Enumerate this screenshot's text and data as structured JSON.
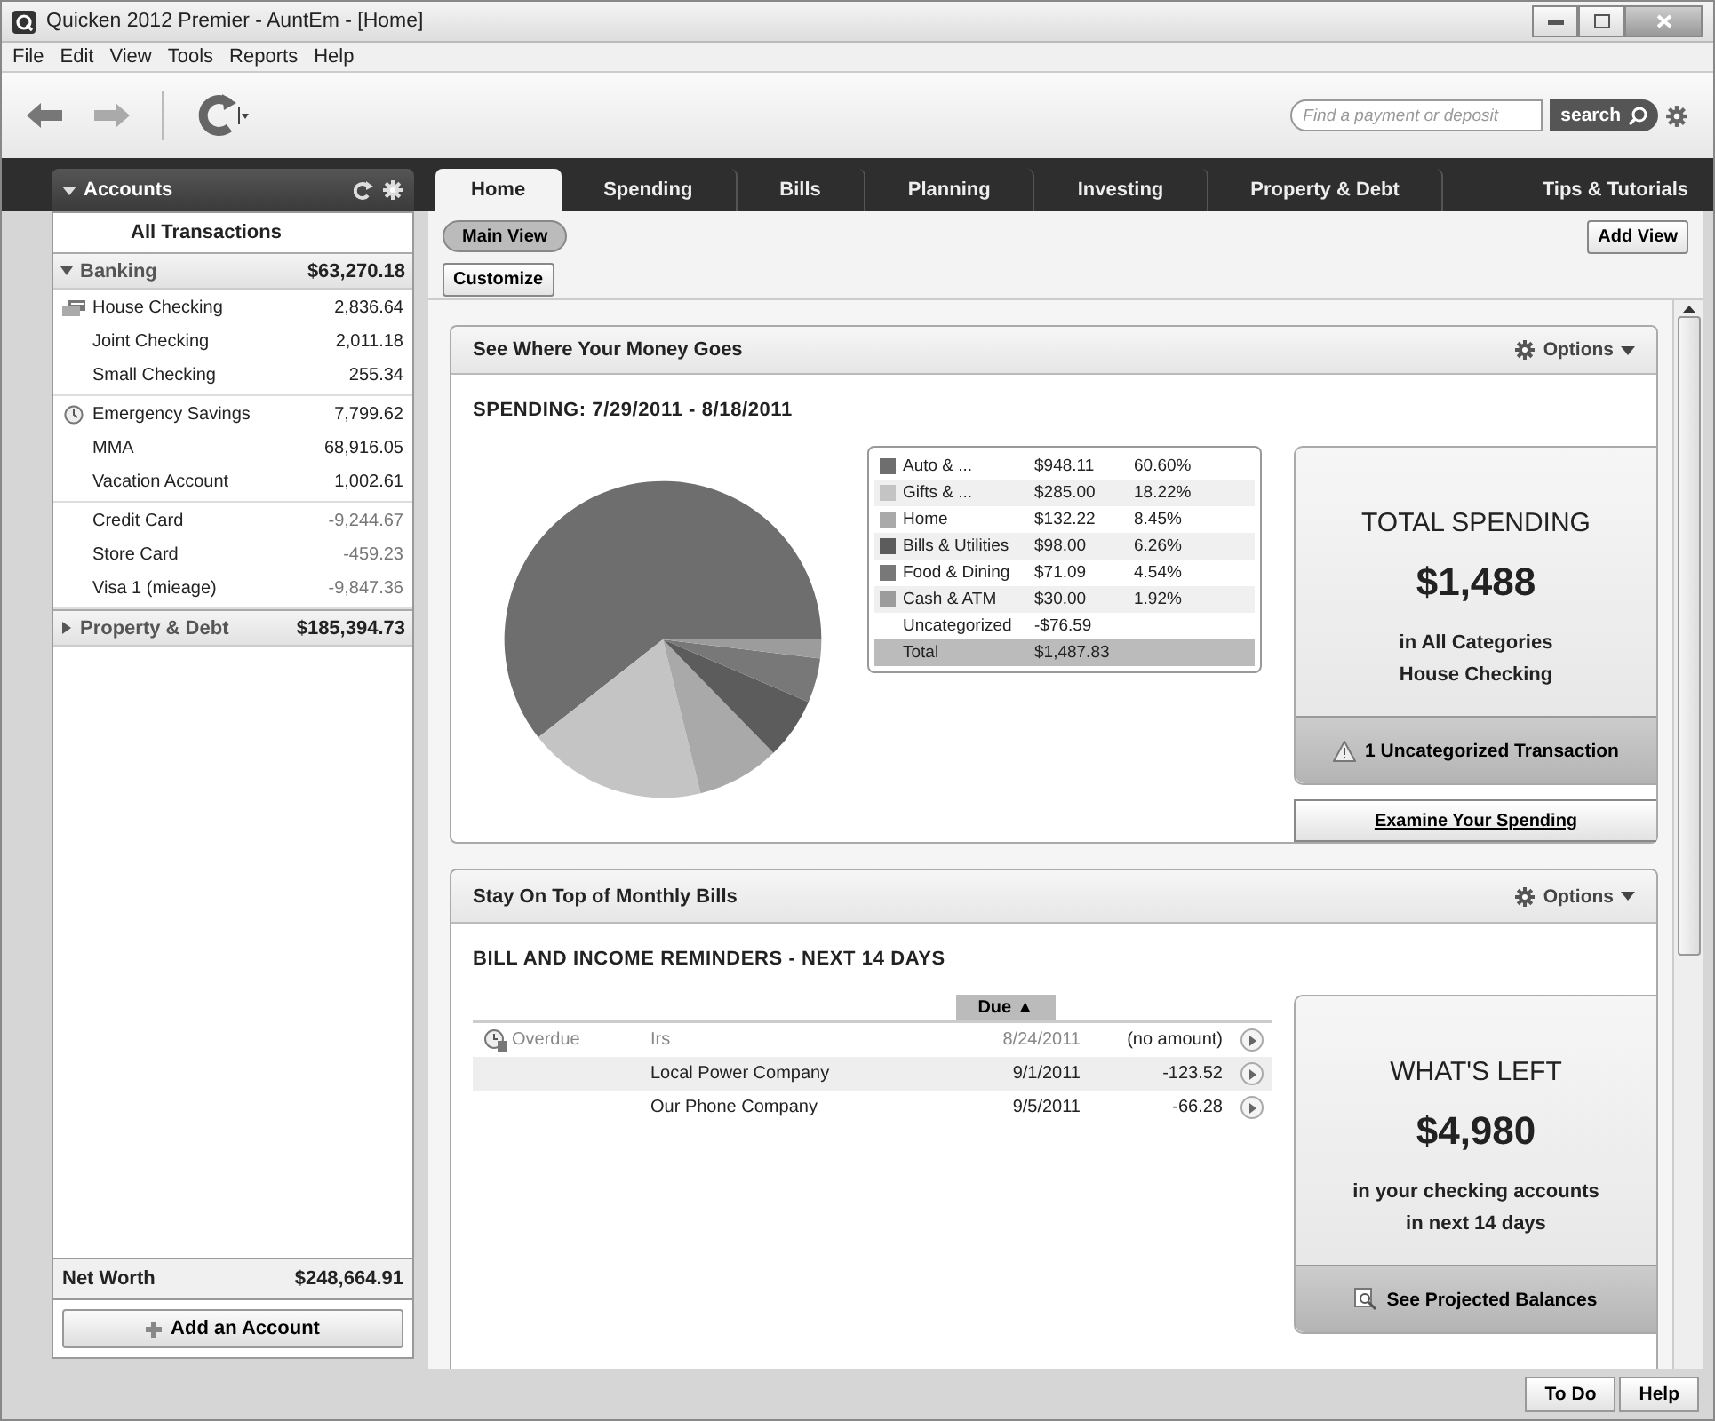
{
  "window": {
    "title": "Quicken 2012 Premier - AuntEm - [Home]"
  },
  "menu": [
    "File",
    "Edit",
    "View",
    "Tools",
    "Reports",
    "Help"
  ],
  "search": {
    "placeholder": "Find a payment or deposit",
    "button": "search"
  },
  "tabs": [
    {
      "label": "Home",
      "selected": true
    },
    {
      "label": "Spending",
      "selected": false
    },
    {
      "label": "Bills",
      "selected": false
    },
    {
      "label": "Planning",
      "selected": false
    },
    {
      "label": "Investing",
      "selected": false
    },
    {
      "label": "Property & Debt",
      "selected": false
    }
  ],
  "tips_tab": "Tips & Tutorials",
  "sidebar": {
    "title": "Accounts",
    "all": "All Transactions",
    "groups": [
      {
        "name": "Banking",
        "total": "$63,270.18",
        "expanded": true,
        "subgroups": [
          [
            {
              "name": "House Checking",
              "balance": "2,836.64",
              "kind": "card",
              "negative": false
            },
            {
              "name": "Joint Checking",
              "balance": "2,011.18",
              "kind": "plain",
              "negative": false
            },
            {
              "name": "Small Checking",
              "balance": "255.34",
              "kind": "plain",
              "negative": false
            }
          ],
          [
            {
              "name": "Emergency Savings",
              "balance": "7,799.62",
              "kind": "clock",
              "negative": false
            },
            {
              "name": "MMA",
              "balance": "68,916.05",
              "kind": "plain",
              "negative": false
            },
            {
              "name": "Vacation Account",
              "balance": "1,002.61",
              "kind": "plain",
              "negative": false
            }
          ],
          [
            {
              "name": "Credit Card",
              "balance": "-9,244.67",
              "kind": "plain",
              "negative": true
            },
            {
              "name": "Store Card",
              "balance": "-459.23",
              "kind": "plain",
              "negative": true
            },
            {
              "name": "Visa 1 (mieage)",
              "balance": "-9,847.36",
              "kind": "plain",
              "negative": true
            }
          ]
        ]
      },
      {
        "name": "Property & Debt",
        "total": "$185,394.73",
        "expanded": false
      }
    ],
    "net_worth": {
      "label": "Net Worth",
      "value": "$248,664.91"
    },
    "add_button": "Add an Account"
  },
  "views": [
    {
      "label": "Main View",
      "selected": true
    }
  ],
  "add_view": "Add View",
  "customize": "Customize",
  "spending": {
    "title": "See Where Your Money Goes",
    "options": "Options",
    "heading": "SPENDING: 7/29/2011 - 8/18/2011",
    "chart_data": {
      "type": "pie",
      "categories": [
        "Auto & ...",
        "Gifts & ...",
        "Home",
        "Bills & Utilities",
        "Food & Dining",
        "Cash & ATM"
      ],
      "values": [
        60.6,
        18.22,
        8.45,
        6.26,
        4.54,
        1.92
      ]
    },
    "legend": [
      {
        "amount": "$948.11",
        "percent": "60.60%",
        "color": "#6e6e6e"
      },
      {
        "amount": "$285.00",
        "percent": "18.22%",
        "color": "#c4c4c4"
      },
      {
        "amount": "$132.22",
        "percent": "8.45%",
        "color": "#a9a9a9"
      },
      {
        "amount": "$98.00",
        "percent": "6.26%",
        "color": "#5c5c5c"
      },
      {
        "amount": "$71.09",
        "percent": "4.54%",
        "color": "#787878"
      },
      {
        "amount": "$30.00",
        "percent": "1.92%",
        "color": "#9c9c9c"
      }
    ],
    "extra_rows": [
      {
        "label": "Uncategorized",
        "amount": "-$76.59",
        "total": false
      },
      {
        "label": "Total",
        "amount": "$1,487.83",
        "total": true
      }
    ],
    "summary": {
      "title": "TOTAL SPENDING",
      "amount": "$1,488",
      "lines": [
        "in All Categories",
        "House Checking"
      ],
      "footer": "1 Uncategorized Transaction"
    },
    "action": "Examine Your Spending"
  },
  "bills": {
    "title": "Stay On Top of Monthly Bills",
    "options": "Options",
    "heading": "BILL AND INCOME REMINDERS - NEXT 14 DAYS",
    "due_header": "Due ▲",
    "rows": [
      {
        "status": "Overdue",
        "payee": "Irs",
        "due": "8/24/2011",
        "amount": "(no amount)",
        "overdue": true
      },
      {
        "payee": "Local Power Company",
        "due": "9/1/2011",
        "amount": "-123.52",
        "overdue": false
      },
      {
        "payee": "Our Phone Company",
        "due": "9/5/2011",
        "amount": "-66.28",
        "overdue": false
      }
    ],
    "summary": {
      "title": "WHAT'S LEFT",
      "amount": "$4,980",
      "lines": [
        "in your checking accounts",
        "in next 14 days"
      ],
      "footer": "See Projected Balances"
    }
  },
  "footer_buttons": [
    "To Do",
    "Help"
  ]
}
